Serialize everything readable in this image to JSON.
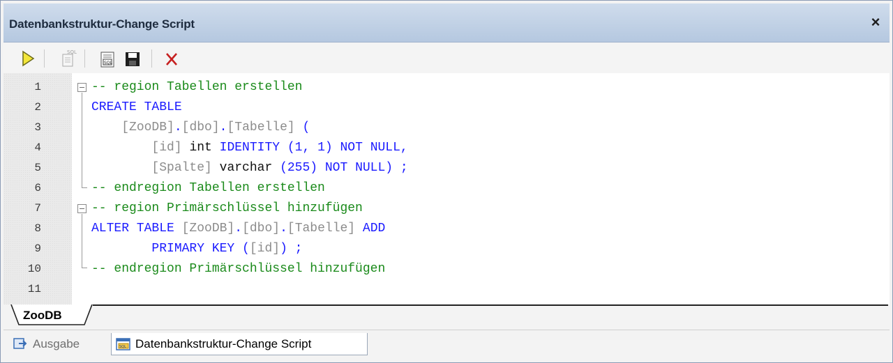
{
  "window": {
    "title": "Datenbankstruktur-Change Script",
    "close_label": "×"
  },
  "toolbar": {
    "buttons": [
      {
        "name": "execute-icon"
      },
      {
        "name": "sql-editor-icon"
      },
      {
        "name": "open-sql-icon"
      },
      {
        "name": "save-icon"
      },
      {
        "name": "delete-icon"
      }
    ]
  },
  "editor": {
    "line_numbers": [
      "1",
      "2",
      "3",
      "4",
      "5",
      "6",
      "7",
      "8",
      "9",
      "10",
      "11"
    ],
    "lines": [
      [
        {
          "t": "-- region Tabellen erstellen",
          "c": "cm"
        }
      ],
      [
        {
          "t": "CREATE TABLE",
          "c": "kw"
        }
      ],
      [
        {
          "t": "    ",
          "c": "tp"
        },
        {
          "t": "[ZooDB]",
          "c": "id"
        },
        {
          "t": ".",
          "c": "kw"
        },
        {
          "t": "[dbo]",
          "c": "id"
        },
        {
          "t": ".",
          "c": "kw"
        },
        {
          "t": "[Tabelle]",
          "c": "id"
        },
        {
          "t": " (",
          "c": "kw"
        }
      ],
      [
        {
          "t": "        ",
          "c": "tp"
        },
        {
          "t": "[id]",
          "c": "id"
        },
        {
          "t": " int ",
          "c": "tp"
        },
        {
          "t": "IDENTITY (1, 1) NOT NULL,",
          "c": "kw"
        }
      ],
      [
        {
          "t": "        ",
          "c": "tp"
        },
        {
          "t": "[Spalte]",
          "c": "id"
        },
        {
          "t": " varchar ",
          "c": "tp"
        },
        {
          "t": "(255) NOT NULL) ;",
          "c": "kw"
        }
      ],
      [
        {
          "t": "-- endregion Tabellen erstellen",
          "c": "cm"
        }
      ],
      [
        {
          "t": "-- region Primärschlüssel hinzufügen",
          "c": "cm"
        }
      ],
      [
        {
          "t": "ALTER TABLE ",
          "c": "kw"
        },
        {
          "t": "[ZooDB]",
          "c": "id"
        },
        {
          "t": ".",
          "c": "kw"
        },
        {
          "t": "[dbo]",
          "c": "id"
        },
        {
          "t": ".",
          "c": "kw"
        },
        {
          "t": "[Tabelle]",
          "c": "id"
        },
        {
          "t": " ADD",
          "c": "kw"
        }
      ],
      [
        {
          "t": "        PRIMARY KEY (",
          "c": "kw"
        },
        {
          "t": "[id]",
          "c": "id"
        },
        {
          "t": ") ;",
          "c": "kw"
        }
      ],
      [
        {
          "t": "-- endregion Primärschlüssel hinzufügen",
          "c": "cm"
        }
      ],
      [
        {
          "t": "",
          "c": "tp"
        }
      ]
    ]
  },
  "db_tabs": {
    "active": "ZooDB"
  },
  "bottom_tabs": {
    "items": [
      {
        "label": "Ausgabe",
        "icon": "output-icon",
        "active": false
      },
      {
        "label": "Datenbankstruktur-Change Script",
        "icon": "change-script-icon",
        "active": true
      }
    ]
  }
}
